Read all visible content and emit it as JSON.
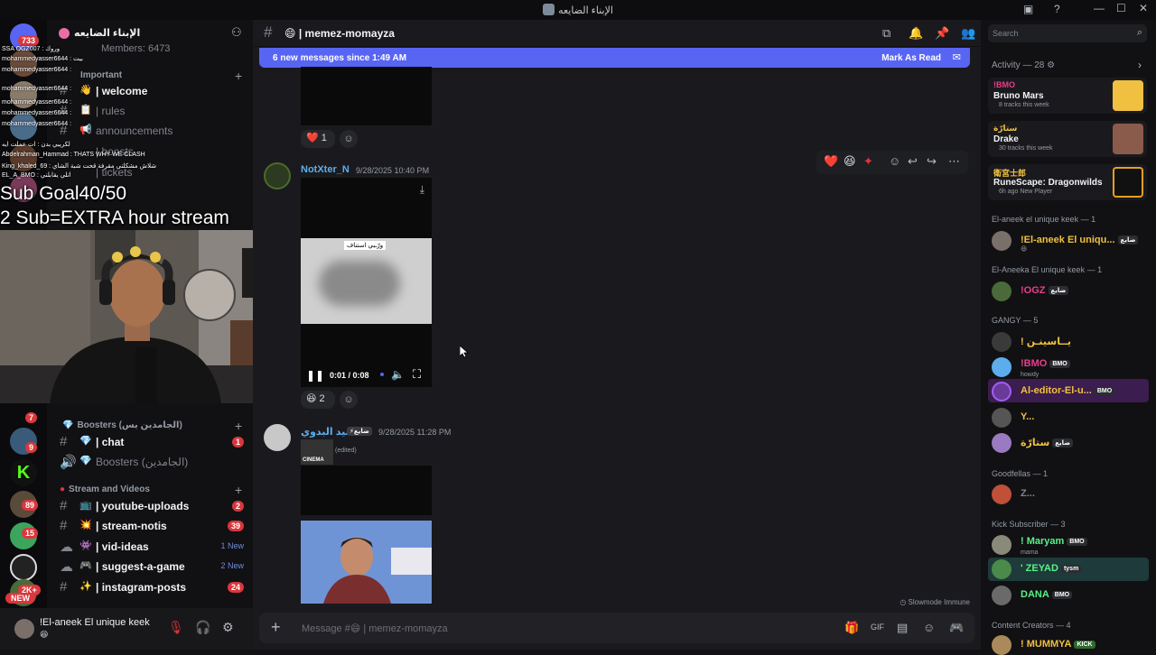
{
  "window": {
    "title": "الإبناء الضايعه",
    "controls": [
      "—",
      "☐",
      "✕"
    ]
  },
  "server_rail": {
    "badges": [
      "733",
      "7",
      "9",
      "89",
      "15",
      "2K+"
    ],
    "new_label": "NEW"
  },
  "channels": {
    "guild_name": "الإبناء الضايعه",
    "members_line": "Members: 6473",
    "category_important": "Important",
    "items_top": [
      {
        "emoji": "👋",
        "label": "| welcome",
        "active": true
      },
      {
        "emoji": "📋",
        "label": "| rules"
      },
      {
        "emoji": "📢",
        "label": "announcements"
      },
      {
        "emoji": "",
        "label": "| boosts"
      },
      {
        "emoji": "",
        "label": "| tickets"
      }
    ],
    "category_boosters": "Boosters (الجامدين بس)",
    "items_boosters": [
      {
        "emoji": "💎",
        "label": "| chat",
        "badge": "1"
      },
      {
        "emoji": "💎",
        "label": "Boosters (الجامدين)"
      }
    ],
    "category_stream": "Stream and Videos",
    "items_stream": [
      {
        "emoji": "📺",
        "label": "| youtube-uploads",
        "badge": "2"
      },
      {
        "emoji": "💥",
        "label": "| stream-notis",
        "badge": "39"
      },
      {
        "emoji": "👾",
        "label": "| vid-ideas",
        "new": "1 New"
      },
      {
        "emoji": "🎮",
        "label": "| suggest-a-game",
        "new": "2 New"
      },
      {
        "emoji": "✨",
        "label": "| instagram-posts",
        "badge": "24"
      }
    ]
  },
  "overlay": {
    "line1": "Sub Goal40/50",
    "line2": "2 Sub=EXTRA hour stream",
    "chat_lines": [
      "SSA OGZ007 : وروك",
      "mohammedyasser6644 : بيت",
      "mohammedyasser6644 :",
      "mohammedyasser6644 :",
      "mohammedyasser6644 :",
      "mohammedyasser6644 :",
      "mohammedyasser6644 :",
      "لكريبي بدن : ات عملت ايه",
      "Abdelrahman_Hammad : THATS WHY WE CLASH",
      "King_khaled_69 : شلاش مشكلتي مقرفة قحت شبة الشاي",
      "EL_A_BMO : اتلي يقابلني"
    ]
  },
  "user_panel": {
    "name": "!El-aneek El unique keek",
    "status": "😆"
  },
  "main": {
    "channel_name": "😄 | memez-momayza",
    "new_messages": "6 new messages since 1:49 AM",
    "mark_read": "Mark As Read",
    "reactions_1": {
      "emoji": "❤️",
      "count": "1"
    },
    "msg1": {
      "author": "NotXter_N",
      "time": "9/28/2025 10:40 PM"
    },
    "video": {
      "time": "0:01 / 0:08",
      "caption": "ورّـبي استناف"
    },
    "reactions_2": {
      "emoji": "😆",
      "count": "2"
    },
    "msg2": {
      "author": "السيد البدوي",
      "tag": "ضايع",
      "time": "9/28/2025 11:28 PM",
      "edited": "(edited)",
      "embed": "CINEMA"
    },
    "slowmode": "Slowmode Immune",
    "composer_placeholder": "Message #😄 | memez-momayza"
  },
  "right": {
    "search_placeholder": "Search",
    "activity_header": "Activity — 28",
    "activities": [
      {
        "user": "!BMO",
        "title": "Bruno Mars",
        "detail": "8 tracks this week",
        "color": "#f0c040"
      },
      {
        "user": "ستارّة",
        "title": "Drake",
        "detail": "30 tracks this week",
        "color": "#8a5a4a"
      },
      {
        "user": "衛宮士郎",
        "title": "RuneScape: Dragonwilds",
        "detail": "6h ago  New Player",
        "color": "#1a1a1a"
      }
    ],
    "groups": [
      {
        "header": "El-aneek el unique keek — 1",
        "members": [
          {
            "name": "!El-aneek El uniqu...",
            "tag": "ضايع",
            "color": "#f0c040",
            "sub": "😆"
          }
        ]
      },
      {
        "header": "El-Aneeka El unique keek — 1",
        "members": [
          {
            "name": "!OGZ",
            "tag": "ضايع",
            "color": "#e83e8c"
          }
        ]
      },
      {
        "header": "GANGY — 5",
        "members": [
          {
            "name": "! يــاسينـن",
            "color": "#f0c040"
          },
          {
            "name": "!BMO",
            "tag": "BMO",
            "color": "#e83e8c",
            "sub": "howdy"
          },
          {
            "name": "Al-editor-El-u...",
            "tag": "BMO",
            "color": "#f0c040",
            "highlight": true
          },
          {
            "name": "Y...",
            "color": "#f0c040"
          },
          {
            "name": "ستارّة",
            "tag": "ضايع",
            "color": "#f0c040"
          }
        ]
      },
      {
        "header": "Goodfellas — 1",
        "members": [
          {
            "name": "Z...",
            "color": "#80848e"
          }
        ]
      },
      {
        "header": "Kick Subscriber — 3",
        "members": [
          {
            "name": "! Maryam",
            "tag": "BMO",
            "color": "#57f287",
            "sub": "mama"
          },
          {
            "name": "' ZEYAD",
            "tag": "tysm",
            "color": "#57f287"
          },
          {
            "name": "DANA",
            "tag": "BMO",
            "color": "#57f287"
          }
        ]
      },
      {
        "header": "Content Creators — 4",
        "members": [
          {
            "name": "! MUMMYA",
            "tag": "KICK",
            "color": "#f0c040"
          }
        ]
      }
    ]
  }
}
